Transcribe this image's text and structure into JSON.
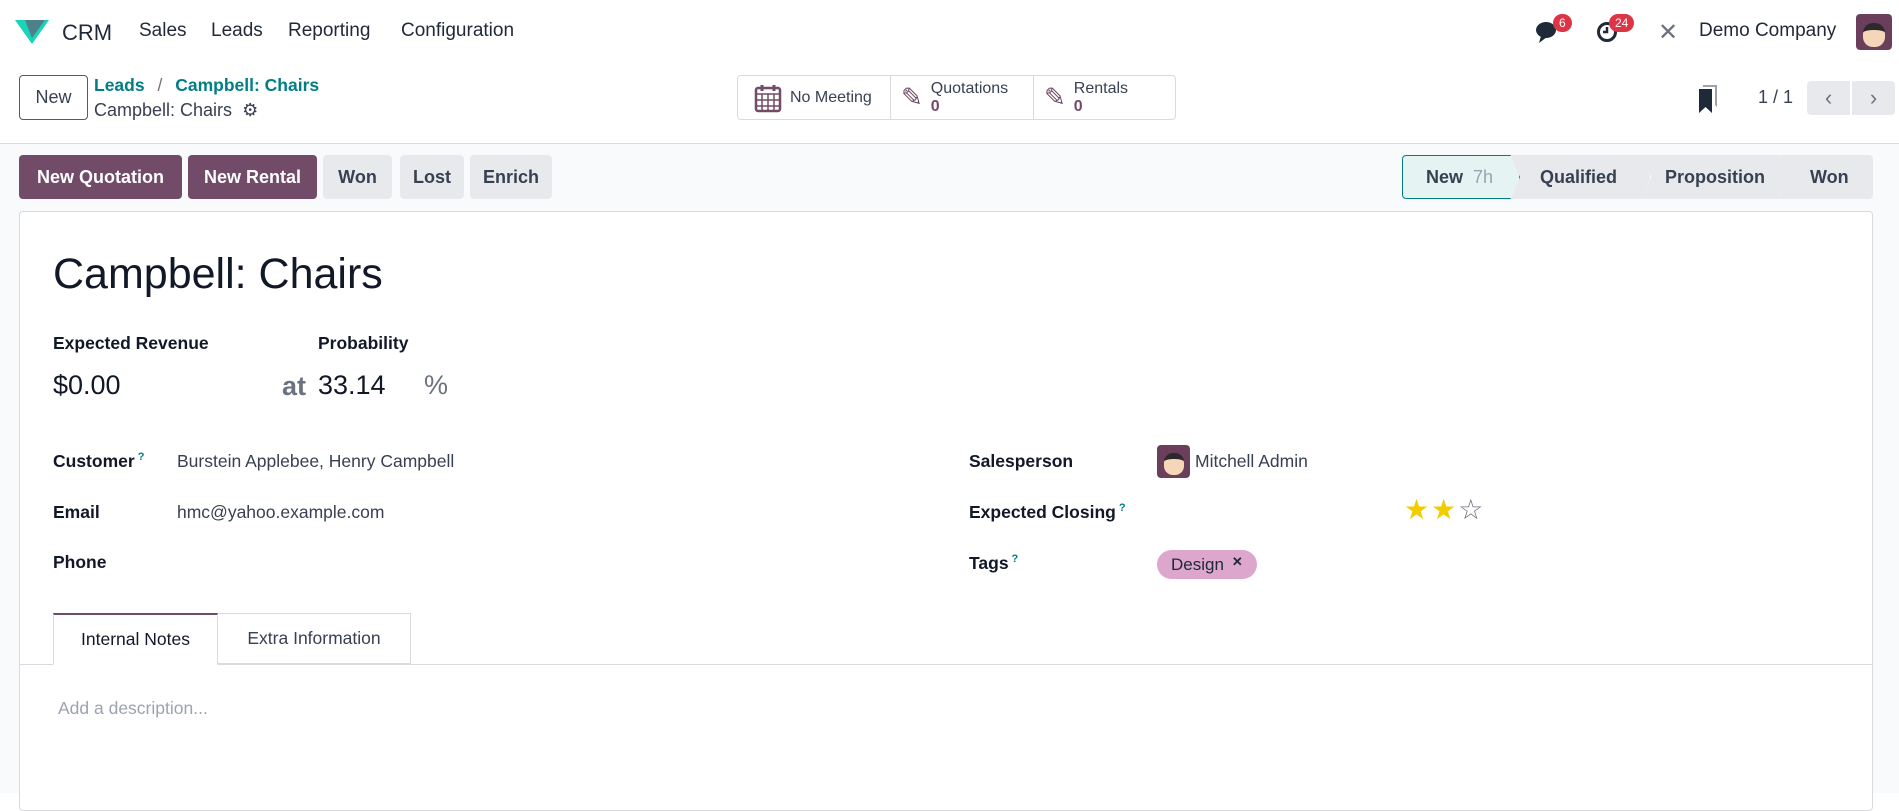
{
  "navbar": {
    "app": "CRM",
    "menus": [
      "Sales",
      "Leads",
      "Reporting",
      "Configuration"
    ],
    "messages_count": "6",
    "activities_count": "24",
    "company": "Demo Company"
  },
  "control_panel": {
    "new_label": "New",
    "breadcrumb": {
      "parent": "Leads",
      "current": "Campbell: Chairs"
    },
    "record_name": "Campbell: Chairs",
    "pager": "1 / 1"
  },
  "smart_buttons": [
    {
      "label": "No Meeting",
      "icon": "calendar-icon"
    },
    {
      "label": "Quotations",
      "value": "0",
      "icon": "edit-icon"
    },
    {
      "label": "Rentals",
      "value": "0",
      "icon": "edit-icon"
    }
  ],
  "actions": [
    "New Quotation",
    "New Rental",
    "Won",
    "Lost",
    "Enrich"
  ],
  "stages": [
    {
      "label": "New",
      "duration": "7h",
      "active": true
    },
    {
      "label": "Qualified"
    },
    {
      "label": "Proposition"
    },
    {
      "label": "Won"
    }
  ],
  "form": {
    "title": "Campbell: Chairs",
    "expected_revenue_label": "Expected Revenue",
    "expected_revenue": "$0.00",
    "at": "at",
    "probability_label": "Probability",
    "probability": "33.14",
    "percent": "%",
    "customer_label": "Customer",
    "customer": "Burstein Applebee, Henry Campbell",
    "email_label": "Email",
    "email": "hmc@yahoo.example.com",
    "phone_label": "Phone",
    "salesperson_label": "Salesperson",
    "salesperson": "Mitchell Admin",
    "expected_closing_label": "Expected Closing",
    "priority_stars": 2,
    "priority_max": 3,
    "tags_label": "Tags",
    "tags": [
      "Design"
    ],
    "help_mark": "?"
  },
  "tabs": [
    "Internal Notes",
    "Extra Information"
  ],
  "description_placeholder": "Add a description...",
  "colors": {
    "brand": "#714b67",
    "accent": "#017e84",
    "tag": "#dca6cd",
    "star": "#f3cc00",
    "badge": "#dc3545"
  }
}
